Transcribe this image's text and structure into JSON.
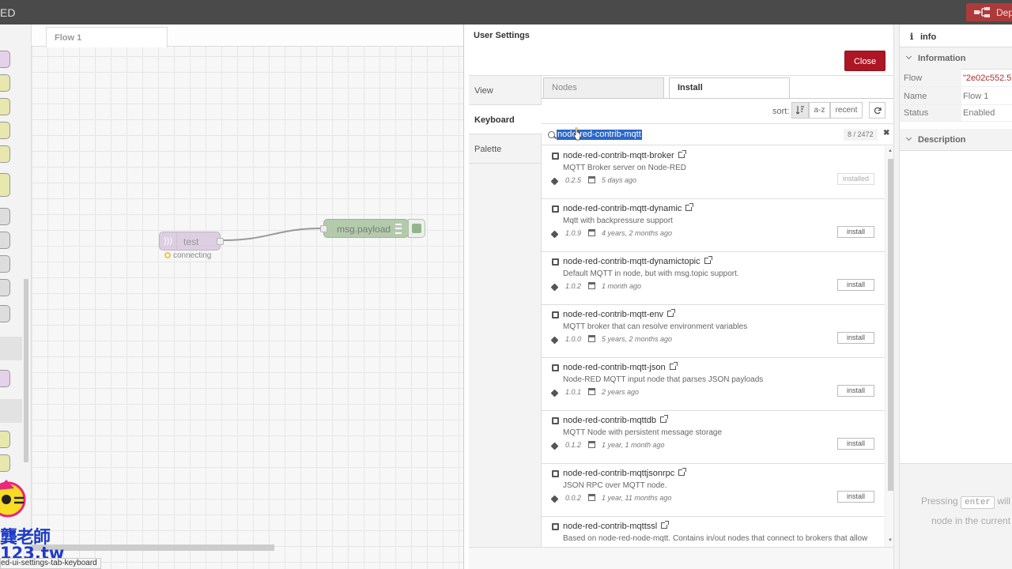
{
  "header": {
    "brand": "ED",
    "deploy_label": "Dep"
  },
  "workspace": {
    "flow_tab": "Flow 1",
    "nodes": [
      {
        "label": "test",
        "status": "connecting"
      },
      {
        "label": "msg.payload"
      }
    ]
  },
  "dialog": {
    "title": "User Settings",
    "close_label": "Close",
    "nav": [
      "View",
      "Keyboard",
      "Palette"
    ],
    "tabs": {
      "nodes": "Nodes",
      "install": "Install"
    },
    "sort": {
      "label": "sort:",
      "az": "a-z",
      "recent": "recent"
    },
    "search": {
      "value": "node-red-contrib-mqtt",
      "count": "8 / 2472"
    },
    "items": [
      {
        "name": "node-red-contrib-mqtt-broker",
        "desc": "MQTT Broker server on Node-RED",
        "version": "0.2.5",
        "date": "5 days ago",
        "action": "installed"
      },
      {
        "name": "node-red-contrib-mqtt-dynamic",
        "desc": "Mqtt with backpressure support",
        "version": "1.0.9",
        "date": "4 years, 2 months ago",
        "action": "install"
      },
      {
        "name": "node-red-contrib-mqtt-dynamictopic",
        "desc": "Default MQTT in node, but with msg.topic support.",
        "version": "1.0.2",
        "date": "1 month ago",
        "action": "install"
      },
      {
        "name": "node-red-contrib-mqtt-env",
        "desc": "MQTT broker that can resolve environment variables",
        "version": "1.0.0",
        "date": "5 years, 2 months ago",
        "action": "install"
      },
      {
        "name": "node-red-contrib-mqtt-json",
        "desc": "Node-RED MQTT input node that parses JSON payloads",
        "version": "1.0.1",
        "date": "2 years ago",
        "action": "install"
      },
      {
        "name": "node-red-contrib-mqttdb",
        "desc": "MQTT Node with persistent message storage",
        "version": "0.1.2",
        "date": "1 year, 1 month ago",
        "action": "install"
      },
      {
        "name": "node-red-contrib-mqttjsonrpc",
        "desc": "JSON RPC over MQTT node.",
        "version": "0.0.2",
        "date": "1 year, 11 months ago",
        "action": "install"
      },
      {
        "name": "node-red-contrib-mqttssl",
        "desc": "Based on node-red-node-mqtt. Contains in/out nodes that connect to brokers that allow",
        "version": "",
        "date": "",
        "action": ""
      }
    ]
  },
  "sidebar": {
    "tab": "info",
    "info_section": "Information",
    "rows": [
      {
        "key": "Flow",
        "value": "\"2e02c552.5"
      },
      {
        "key": "Name",
        "value": "Flow 1"
      },
      {
        "key": "Status",
        "value": "Enabled"
      }
    ],
    "desc_section": "Description",
    "hint_pre": "Pressing",
    "hint_key": "enter",
    "hint_post": "will",
    "hint_line2": "node in the current"
  },
  "status_url": "ed-ui-settings-tab-keyboard",
  "logo_text": {
    "top": "龔老師",
    "bottom": "123.tw"
  },
  "colors": {
    "accent_red": "#ad1625",
    "selection": "#2a67c8",
    "deploy": "#ad3a3a"
  }
}
